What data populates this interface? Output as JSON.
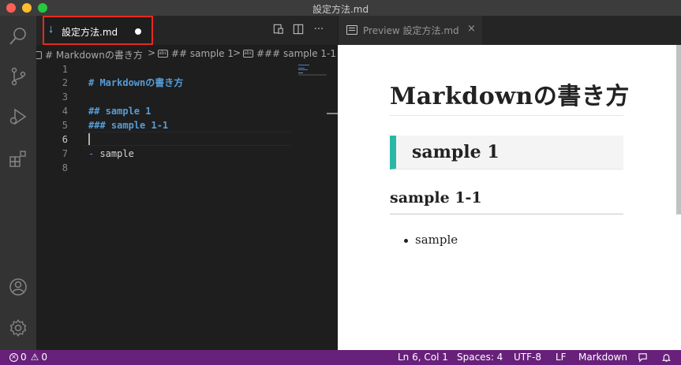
{
  "window": {
    "title": "設定方法.md"
  },
  "editor_tab": {
    "label": "設定方法.md",
    "file_icon": "markdown-arrow-icon",
    "dirty": true
  },
  "editor_actions": {
    "preview_side": "open-preview-to-side-icon",
    "split": "split-editor-icon",
    "more": "···"
  },
  "breadcrumb": {
    "items": [
      "# Markdownの書き方",
      "## sample 1",
      "### sample 1-1"
    ],
    "symbol_glyph": "abc",
    "separator": ">"
  },
  "code_lines": [
    {
      "num": "1",
      "text": ""
    },
    {
      "num": "2",
      "text": "# Markdownの書き方"
    },
    {
      "num": "3",
      "text": ""
    },
    {
      "num": "4",
      "text": "## sample 1"
    },
    {
      "num": "5",
      "text": "### sample 1-1"
    },
    {
      "num": "6",
      "text": ""
    },
    {
      "num": "7",
      "marker": "-",
      "text": " sample"
    },
    {
      "num": "8",
      "text": ""
    }
  ],
  "preview_tab": {
    "label": "Preview 設定方法.md",
    "close": "×"
  },
  "preview": {
    "h1": "Markdownの書き方",
    "h2": "sample 1",
    "h3": "sample 1-1",
    "list_item": "sample"
  },
  "statusbar": {
    "errors": "0",
    "warnings": "0",
    "position": "Ln 6, Col 1",
    "spaces": "Spaces: 4",
    "encoding": "UTF-8",
    "eol": "LF",
    "language": "Markdown"
  },
  "colors": {
    "accent_status": "#68217a",
    "h2_border": "#2bb7a6",
    "tab_highlight": "#e8291c",
    "markdown_heading": "#569cd6"
  }
}
